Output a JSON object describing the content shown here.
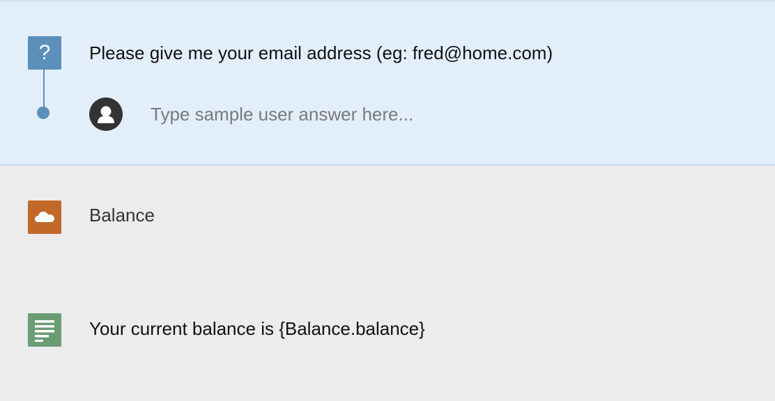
{
  "question_step": {
    "icon": "question-icon",
    "text": "Please give me your email address (eg: fred@home.com)",
    "answer": {
      "avatar_icon": "user-avatar-icon",
      "value": "",
      "placeholder": "Type sample user answer here..."
    }
  },
  "api_step": {
    "icon": "cloud-icon",
    "label": "Balance"
  },
  "text_step": {
    "icon": "text-lines-icon",
    "content": "Your current balance is {Balance.balance}"
  },
  "colors": {
    "question_block_bg": "#e3eefb",
    "page_bg": "#ececec",
    "question_icon": "#5c8fba",
    "api_icon": "#c0692b",
    "text_icon": "#6b9c74",
    "avatar": "#333333"
  }
}
